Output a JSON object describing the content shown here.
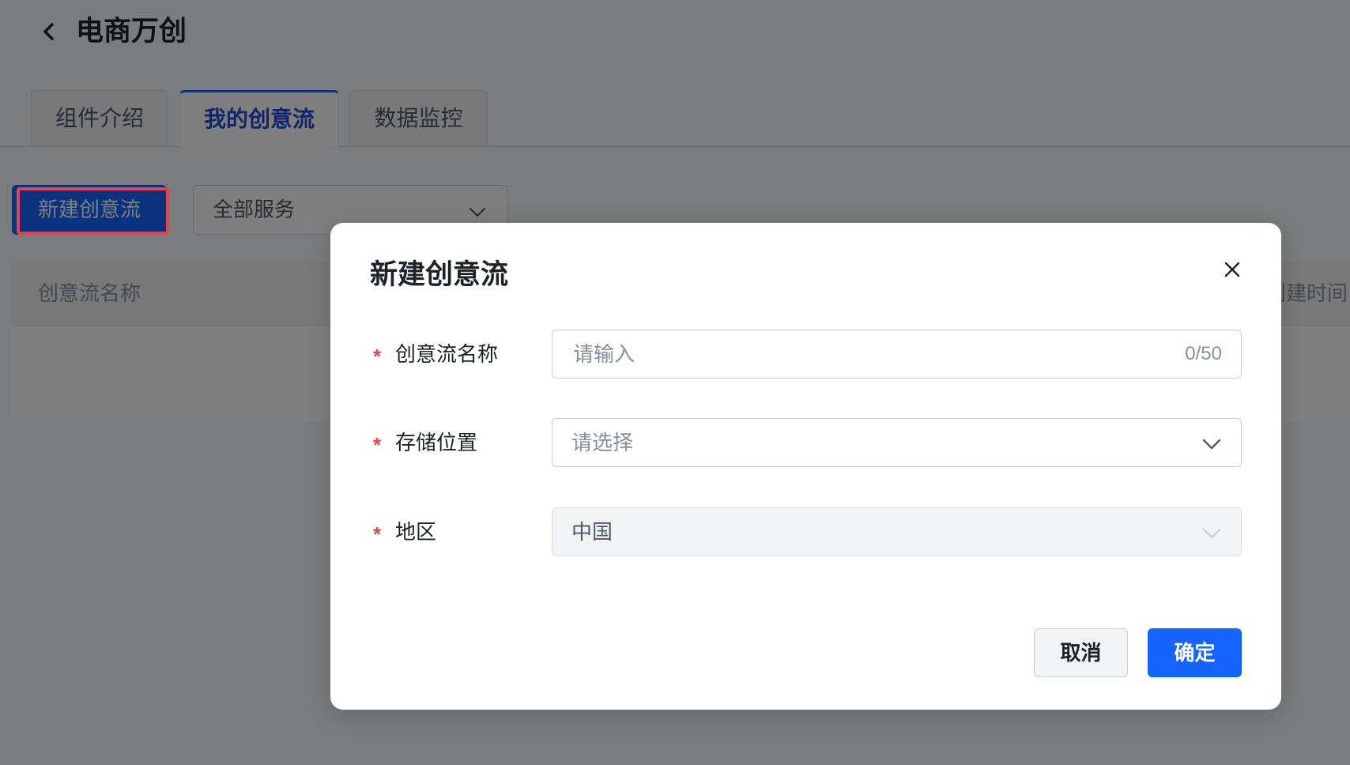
{
  "header": {
    "title": "电商万创"
  },
  "tabs": [
    {
      "label": "组件介绍",
      "active": false
    },
    {
      "label": "我的创意流",
      "active": true
    },
    {
      "label": "数据监控",
      "active": false
    }
  ],
  "toolbar": {
    "new_button_label": "新建创意流",
    "service_select_value": "全部服务"
  },
  "table": {
    "columns": [
      "创意流名称",
      "创建时间"
    ]
  },
  "dialog": {
    "title": "新建创意流",
    "required_mark": "*",
    "fields": [
      {
        "label": "创意流名称",
        "placeholder": "请输入",
        "counter": "0/50"
      },
      {
        "label": "存储位置",
        "placeholder": "请选择"
      },
      {
        "label": "地区",
        "value": "中国",
        "disabled": true
      }
    ],
    "cancel_label": "取消",
    "confirm_label": "确定"
  },
  "icons": {
    "back": "chevron-left-icon",
    "close": "close-icon",
    "dropdown": "chevron-down-icon"
  },
  "colors": {
    "primary": "#1664ff",
    "active_tab_text": "#1f4bd1",
    "required": "#e8414a",
    "highlight": "#e8414a",
    "overlay": "rgba(0,0,0,0.5)"
  }
}
